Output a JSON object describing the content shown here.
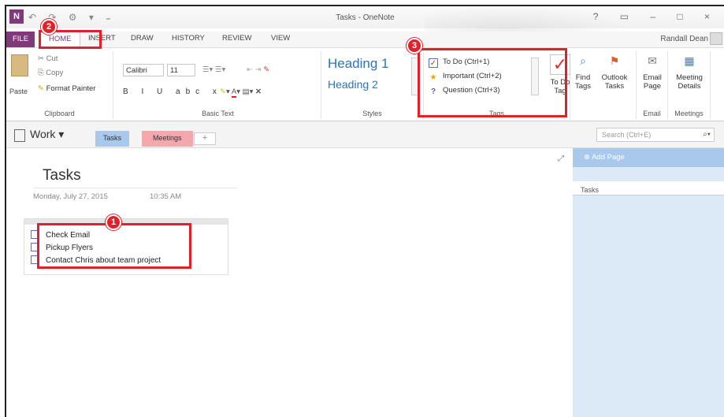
{
  "window": {
    "title": "Tasks - OneNote",
    "user": "Randall Dean",
    "controls": "?   ▭  –  □  ×"
  },
  "qat": "↶ ↷ ⚙ ▾ ₌",
  "app_icon": "N",
  "tabs": [
    "FILE",
    "HOME",
    "INSERT",
    "DRAW",
    "HISTORY",
    "REVIEW",
    "VIEW"
  ],
  "ribbon": {
    "clipboard": {
      "paste": "Paste",
      "cut": "Cut",
      "copy": "Copy",
      "format_painter": "Format Painter",
      "label": "Clipboard"
    },
    "basic_text": {
      "font": "Calibri",
      "size": "11",
      "format_row": "B I U abc x₂ ▾",
      "label": "Basic Text"
    },
    "styles": {
      "heading1": "Heading 1",
      "heading2": "Heading 2",
      "label": "Styles"
    },
    "tags": {
      "items": [
        {
          "label": "To Do (Ctrl+1)",
          "icon": "checkbox-icon"
        },
        {
          "label": "Important (Ctrl+2)",
          "icon": "star-icon"
        },
        {
          "label": "Question (Ctrl+3)",
          "icon": "question-icon"
        }
      ],
      "todo_tag": "To Do Tag",
      "label": "Tags"
    },
    "find_tags": "Find Tags",
    "outlook_tasks": "Outlook Tasks",
    "email_page": "Email Page",
    "email_label": "Email",
    "meeting_details": "Meeting Details",
    "meetings_label": "Meetings"
  },
  "notebook": {
    "name": "Work",
    "sections": [
      "Tasks",
      "Meetings"
    ],
    "add_section": "+",
    "search_placeholder": "Search (Ctrl+E)"
  },
  "page": {
    "title": "Tasks",
    "date": "Monday, July 27, 2015",
    "time": "10:35 AM",
    "todos": [
      "Check Email",
      "Pickup Flyers",
      "Contact Chris about team project"
    ]
  },
  "page_list": {
    "add_page": "Add Page",
    "items": [
      "Tasks"
    ]
  },
  "annotations": [
    "1",
    "2",
    "3"
  ],
  "colors": {
    "accent": "#80397b",
    "annotation": "#e2202a",
    "tasks_section": "#a8c9ec",
    "meetings_section": "#f2a8ad"
  }
}
